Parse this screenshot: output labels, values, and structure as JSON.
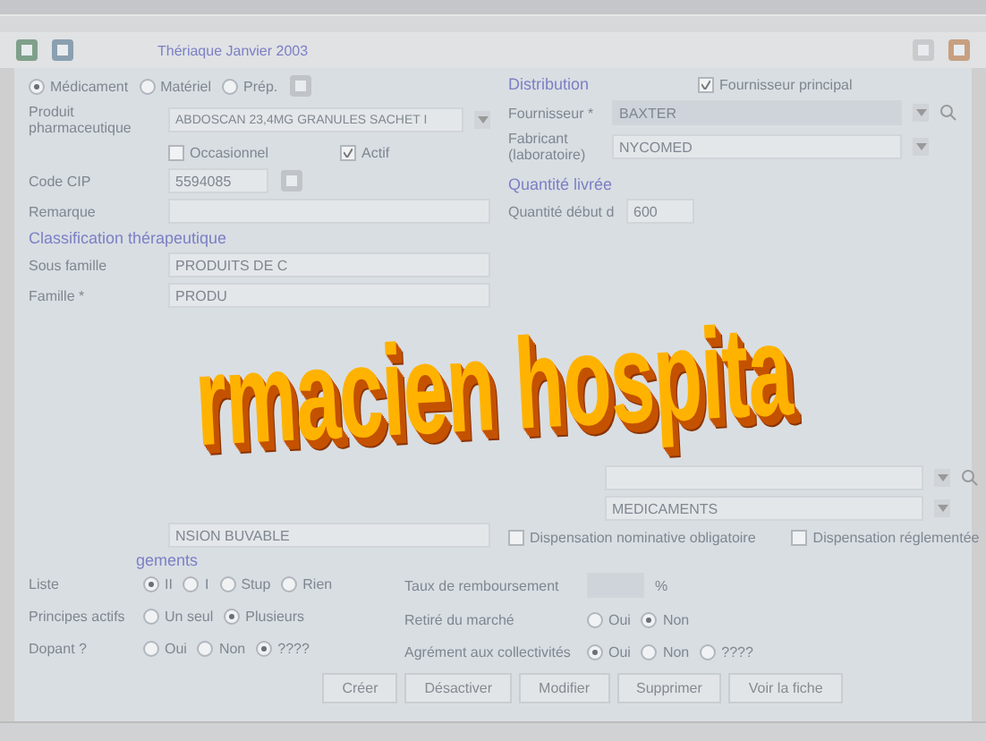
{
  "toolbar": {
    "caption": "Thériaque Janvier 2003"
  },
  "product_type": [
    {
      "label": "Médicament",
      "selected": true
    },
    {
      "label": "Matériel",
      "selected": false
    },
    {
      "label": "Prép.",
      "selected": false
    }
  ],
  "produit": {
    "label": "Produit pharmaceutique",
    "value": "ABDOSCAN 23,4MG GRANULES SACHET I"
  },
  "flags": [
    {
      "label": "Occasionnel",
      "checked": false
    },
    {
      "label": "Actif",
      "checked": true
    }
  ],
  "code_cip": {
    "label": "Code CIP",
    "value": "5594085"
  },
  "remarque": {
    "label": "Remarque"
  },
  "classification": {
    "heading": "Classification thérapeutique",
    "rows": [
      {
        "label": "Sous famille",
        "value": "PRODUITS DE C"
      },
      {
        "label": "Famille *",
        "value": "PRODU"
      }
    ]
  },
  "forme": {
    "value": "NSION BUVABLE"
  },
  "distribution": {
    "heading": "Distribution",
    "principal": {
      "label": "Fournisseur principal",
      "checked": true
    },
    "rows": [
      {
        "label": "Fournisseur *",
        "value": "BAXTER",
        "search": true
      },
      {
        "label": "Fabricant (laboratoire)",
        "value": "NYCOMED",
        "search": false
      }
    ]
  },
  "quantite": {
    "heading": "Quantité livrée",
    "label": "Quantité début d",
    "value": "600"
  },
  "type": {
    "value": "MEDICAMENTS"
  },
  "dispensation": [
    {
      "label": "Dispensation nominative obligatoire",
      "checked": false
    },
    {
      "label": "Dispensation réglementée",
      "checked": false
    }
  ],
  "renseignements": {
    "heading": "gements",
    "left": [
      {
        "label": "Liste",
        "options": [
          {
            "label": "II",
            "selected": true
          },
          {
            "label": "I",
            "selected": false
          },
          {
            "label": "Stup",
            "selected": false
          },
          {
            "label": "Rien",
            "selected": false
          }
        ]
      },
      {
        "label": "Principes actifs",
        "options": [
          {
            "label": "Un seul",
            "selected": false
          },
          {
            "label": "Plusieurs",
            "selected": true
          }
        ]
      },
      {
        "label": "Dopant ?",
        "options": [
          {
            "label": "Oui",
            "selected": false
          },
          {
            "label": "Non",
            "selected": false
          },
          {
            "label": "????",
            "selected": true
          }
        ]
      }
    ],
    "taux": {
      "label": "Taux de remboursement",
      "unit": "%"
    },
    "right": [
      {
        "label": "Retiré du marché",
        "options": [
          {
            "label": "Oui",
            "selected": false
          },
          {
            "label": "Non",
            "selected": true
          }
        ]
      },
      {
        "label": "Agrément aux collectivités",
        "options": [
          {
            "label": "Oui",
            "selected": true
          },
          {
            "label": "Non",
            "selected": false
          },
          {
            "label": "????",
            "selected": false
          }
        ]
      }
    ]
  },
  "buttons": [
    "Créer",
    "Désactiver",
    "Modifier",
    "Supprimer",
    "Voir la fiche"
  ],
  "wordart": "rmacien hospita"
}
